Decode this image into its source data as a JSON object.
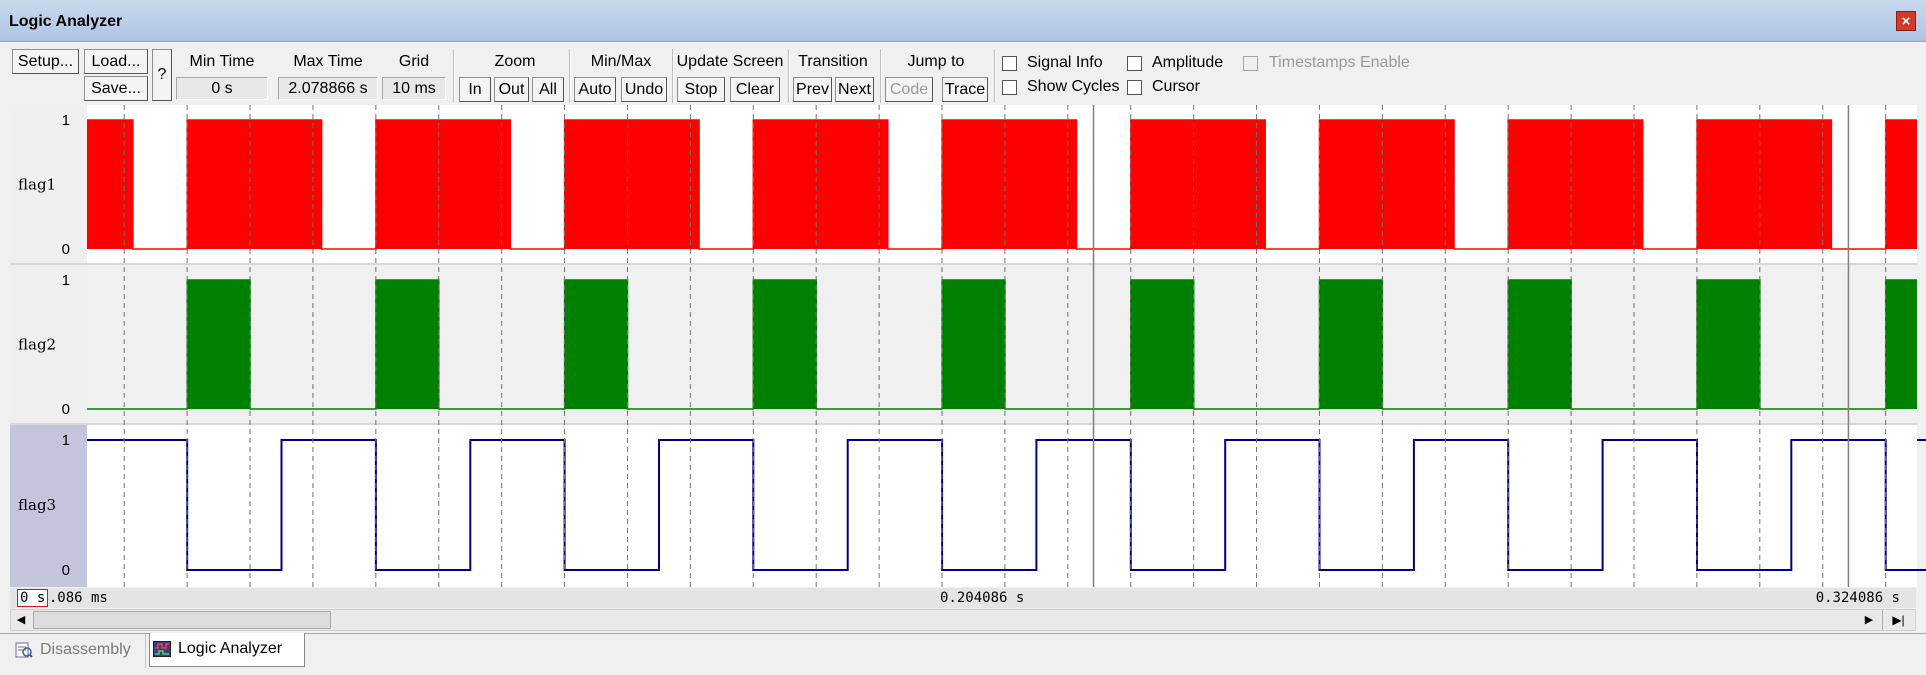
{
  "window": {
    "title": "Logic Analyzer",
    "close_glyph": "×"
  },
  "toolbar": {
    "setup": "Setup...",
    "load": "Load...",
    "save": "Save...",
    "help": "?",
    "min_time": {
      "label": "Min Time",
      "value": "0 s"
    },
    "max_time": {
      "label": "Max Time",
      "value": "2.078866 s"
    },
    "grid": {
      "label": "Grid",
      "value": "10 ms"
    },
    "zoom": {
      "label": "Zoom",
      "in": "In",
      "out": "Out",
      "all": "All"
    },
    "minmax": {
      "label": "Min/Max",
      "auto": "Auto",
      "undo": "Undo"
    },
    "update": {
      "label": "Update Screen",
      "stop": "Stop",
      "clear": "Clear"
    },
    "transition": {
      "label": "Transition",
      "prev": "Prev",
      "next": "Next"
    },
    "jump": {
      "label": "Jump to",
      "code": "Code",
      "trace": "Trace"
    },
    "options": {
      "signal_info": {
        "label": "Signal Info",
        "checked": false
      },
      "show_cycles": {
        "label": "Show Cycles",
        "checked": false
      },
      "amplitude": {
        "label": "Amplitude",
        "checked": false
      },
      "cursor": {
        "label": "Cursor",
        "checked": false
      },
      "timestamps": {
        "label": "Timestamps Enable",
        "checked": false,
        "enabled": false
      }
    }
  },
  "signals": [
    {
      "name": "flag1",
      "high_label": "1",
      "low_label": "0",
      "color": "#ff0000",
      "style": "filled",
      "edges": [
        51.38,
        60.01,
        81.38,
        90.01,
        111.38,
        120.01,
        141.38,
        150.01,
        171.38,
        180.01,
        201.38,
        210.01,
        231.38,
        240.01,
        261.38,
        270.01,
        291.38,
        300.01,
        321.38,
        330.01
      ],
      "initial_level": 1
    },
    {
      "name": "flag2",
      "high_label": "1",
      "low_label": "0",
      "color": "#008000",
      "style": "filled",
      "edges": [
        60.01,
        70.01,
        90.01,
        100.01,
        120.01,
        130.01,
        150.01,
        160.01,
        180.01,
        190.01,
        210.01,
        220.01,
        240.01,
        250.01,
        270.01,
        280.01,
        300.01,
        310.01,
        330.01
      ],
      "initial_level": 0
    },
    {
      "name": "flag3",
      "high_label": "1",
      "low_label": "0",
      "color": "#000080",
      "style": "line",
      "edges": [
        60.01,
        75.01,
        90.01,
        105.01,
        120.01,
        135.01,
        150.01,
        165.01,
        180.01,
        195.01,
        210.01,
        225.01,
        240.01,
        255.01,
        270.01,
        285.01,
        300.01,
        315.01,
        330.01,
        345.01
      ],
      "initial_level": 1
    }
  ],
  "view": {
    "start_ms": 44.086,
    "end_ms": 334.986,
    "grid_ms": 10
  },
  "time_axis": {
    "left": "44.086 ms",
    "mid": "0.204086 s",
    "right": "0.324086 s",
    "cursor_value": "0 s"
  },
  "tabs": [
    {
      "label": "Disassembly",
      "icon": "disassembly-icon",
      "active": false
    },
    {
      "label": "Logic Analyzer",
      "icon": "logic-analyzer-icon",
      "active": true
    }
  ]
}
